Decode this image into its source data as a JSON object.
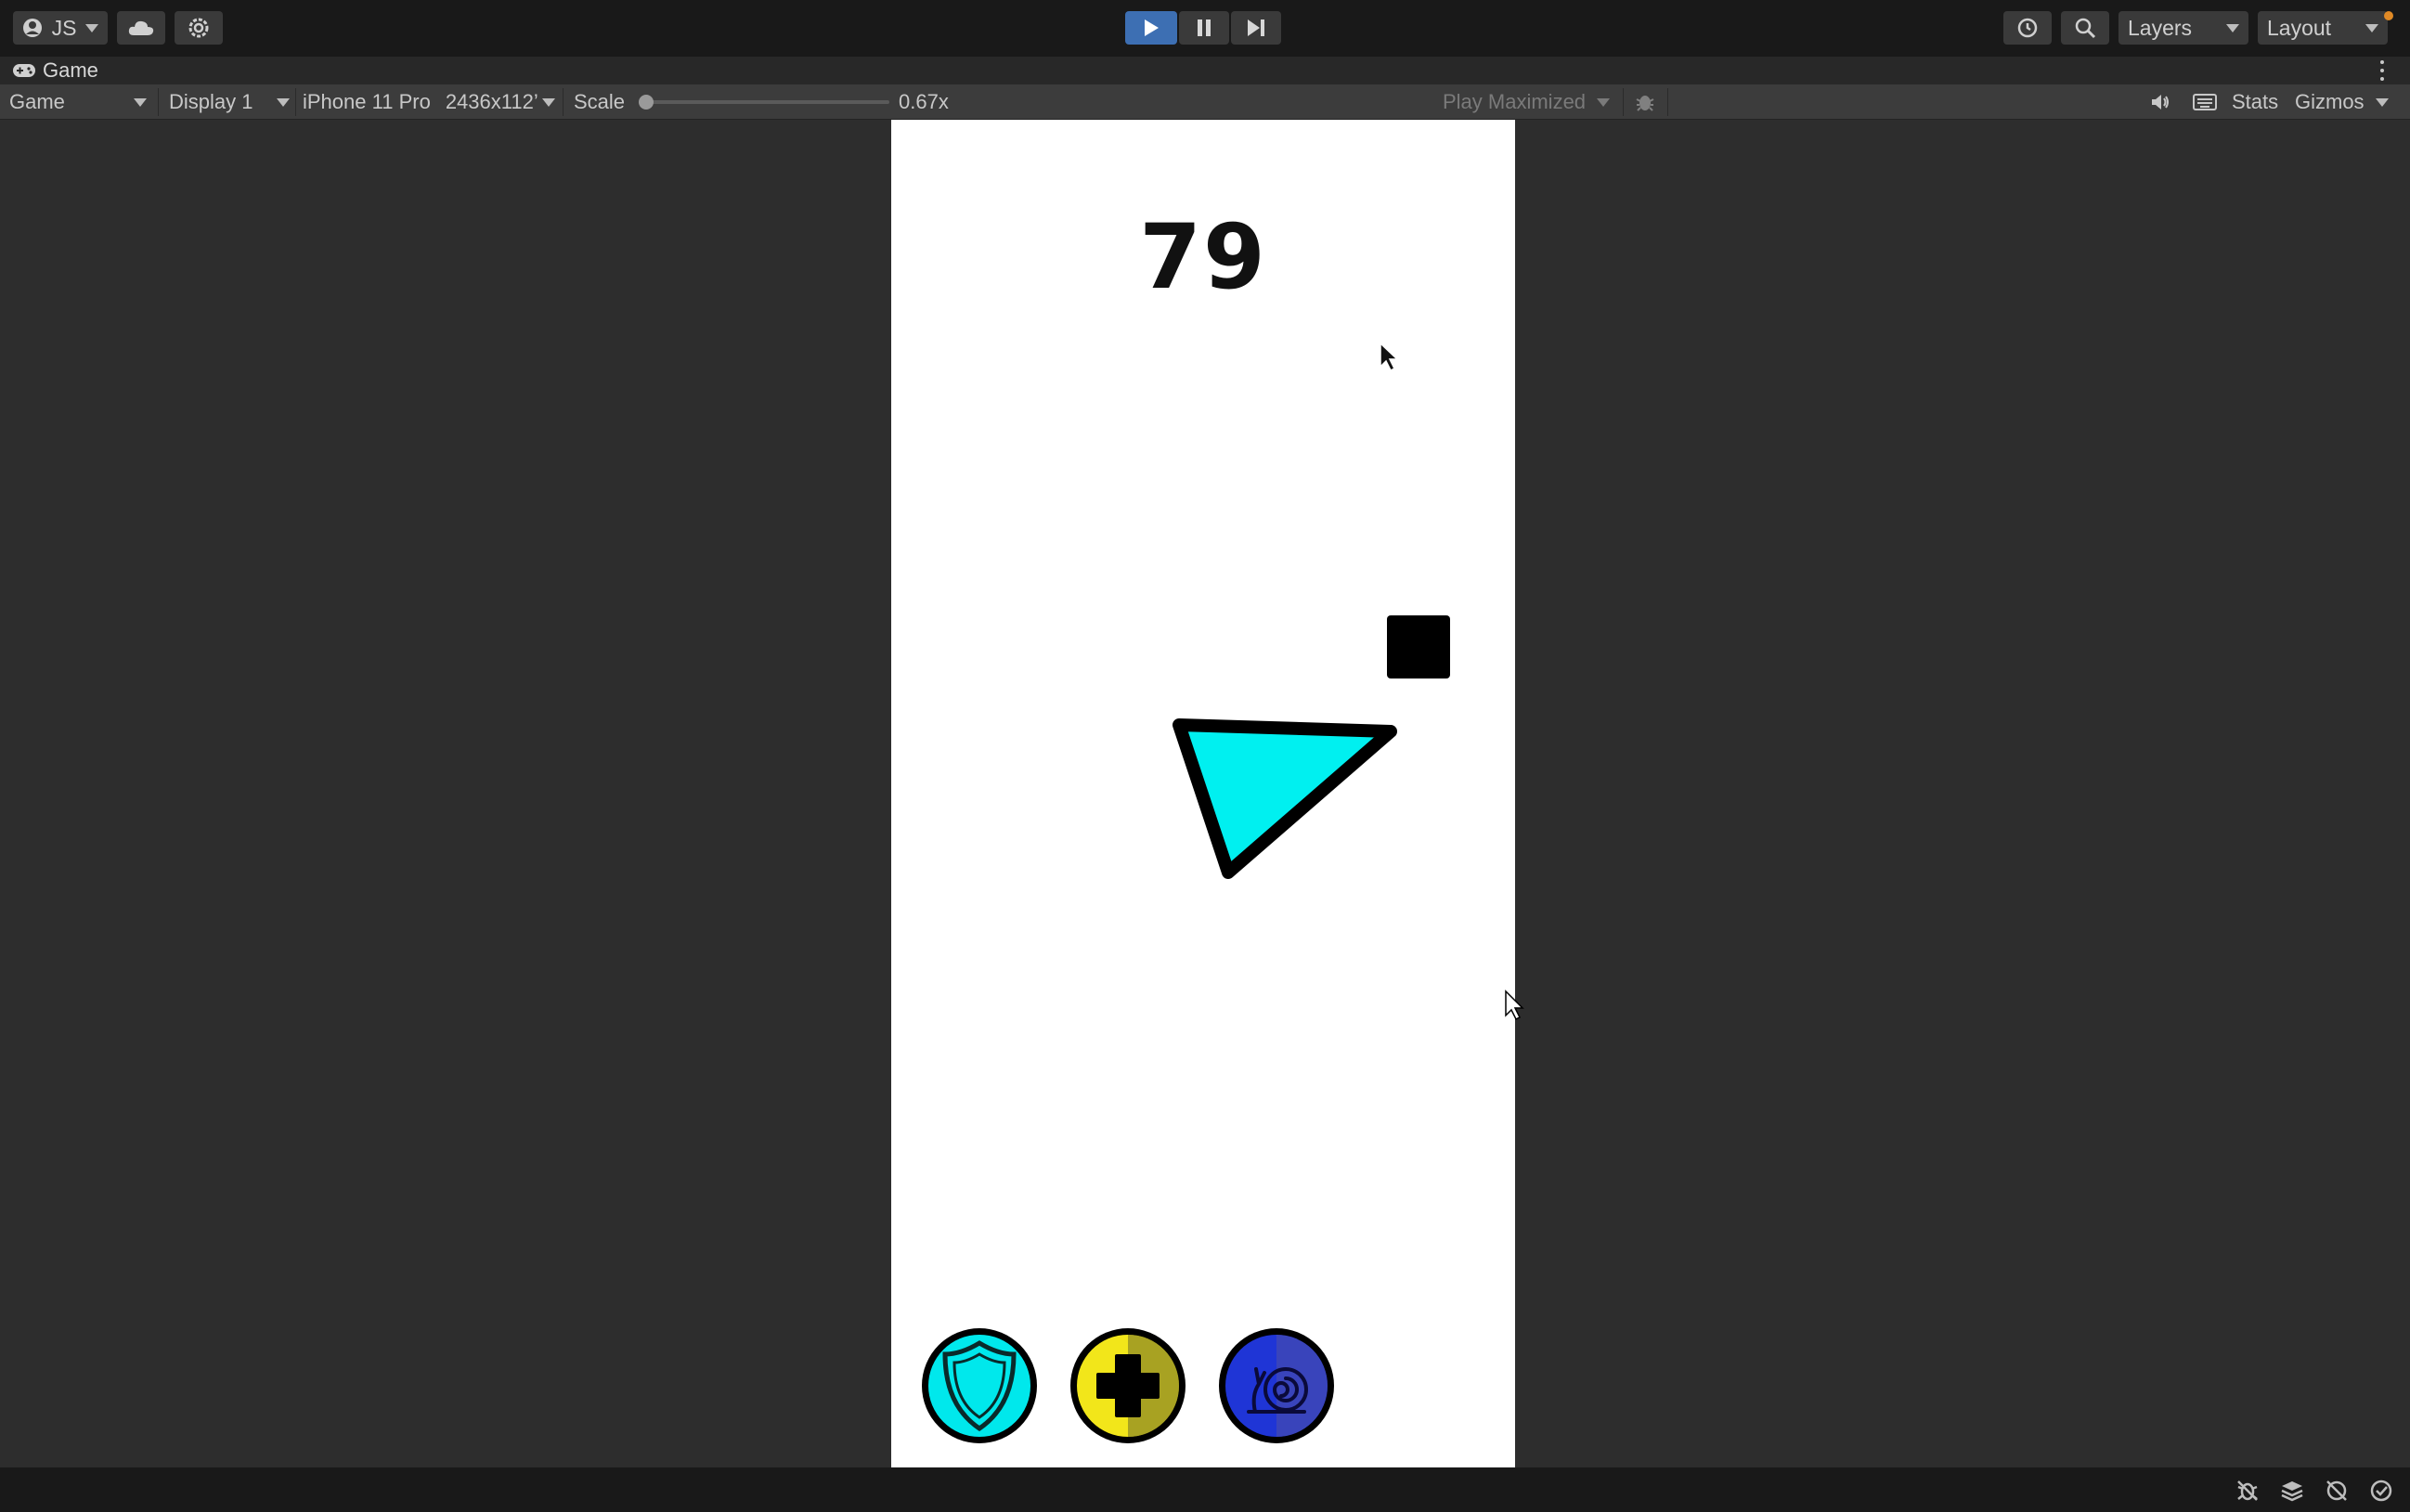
{
  "topbar": {
    "account_label": "JS",
    "layers_label": "Layers",
    "layout_label": "Layout"
  },
  "tab": {
    "title": "Game"
  },
  "toolbar": {
    "view_mode": "Game",
    "display": "Display 1",
    "device": "iPhone 11 Pro",
    "resolution": "2436x112’",
    "scale_label": "Scale",
    "scale_value": "0.67x",
    "play_mode": "Play Maximized",
    "stats_label": "Stats",
    "gizmos_label": "Gizmos"
  },
  "game": {
    "score": "79",
    "colors": {
      "player_fill": "#00f0f0",
      "powerup_shield": "#00e8ec",
      "powerup_health": "#f2e61a",
      "powerup_slow": "#1f35d6"
    },
    "powerups": [
      {
        "name": "shield",
        "icon": "shield-icon"
      },
      {
        "name": "health",
        "icon": "plus-icon"
      },
      {
        "name": "slow",
        "icon": "snail-icon"
      }
    ]
  }
}
